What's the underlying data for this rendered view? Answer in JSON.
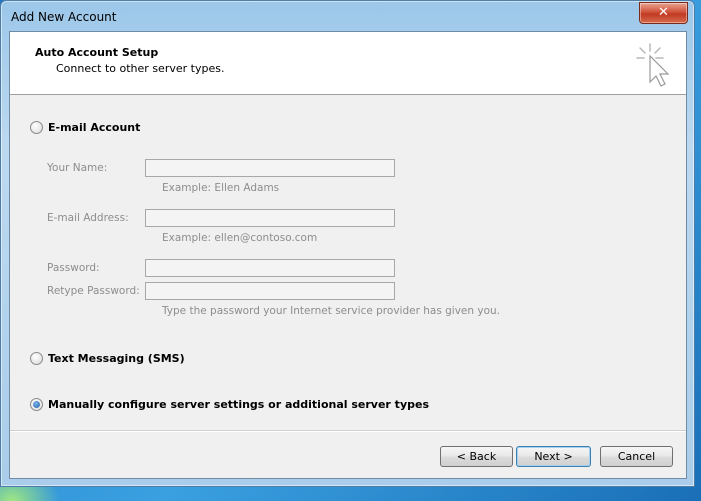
{
  "window": {
    "title": "Add New Account",
    "close_glyph": "✕"
  },
  "header": {
    "title": "Auto Account Setup",
    "subtitle": "Connect to other server types.",
    "icon": "wizard-cursor-icon"
  },
  "options": {
    "email_account": {
      "label": "E-mail Account",
      "checked": false
    },
    "text_messaging": {
      "label": "Text Messaging (SMS)",
      "checked": false
    },
    "manual": {
      "label": "Manually configure server settings or additional server types",
      "checked": true
    }
  },
  "fields": {
    "your_name": {
      "label": "Your Name:",
      "value": "",
      "hint": "Example: Ellen Adams"
    },
    "email_address": {
      "label": "E-mail Address:",
      "value": "",
      "hint": "Example: ellen@contoso.com"
    },
    "password": {
      "label": "Password:",
      "value": ""
    },
    "retype_password": {
      "label": "Retype Password:",
      "value": ""
    },
    "password_hint": "Type the password your Internet service provider has given you."
  },
  "buttons": {
    "back": "< Back",
    "next": "Next >",
    "cancel": "Cancel"
  },
  "colors": {
    "title_bar": "#a9cdea",
    "close_button": "#c03a22",
    "disabled_text": "#8d8d8d",
    "radio_selected": "#1c5fa8"
  }
}
